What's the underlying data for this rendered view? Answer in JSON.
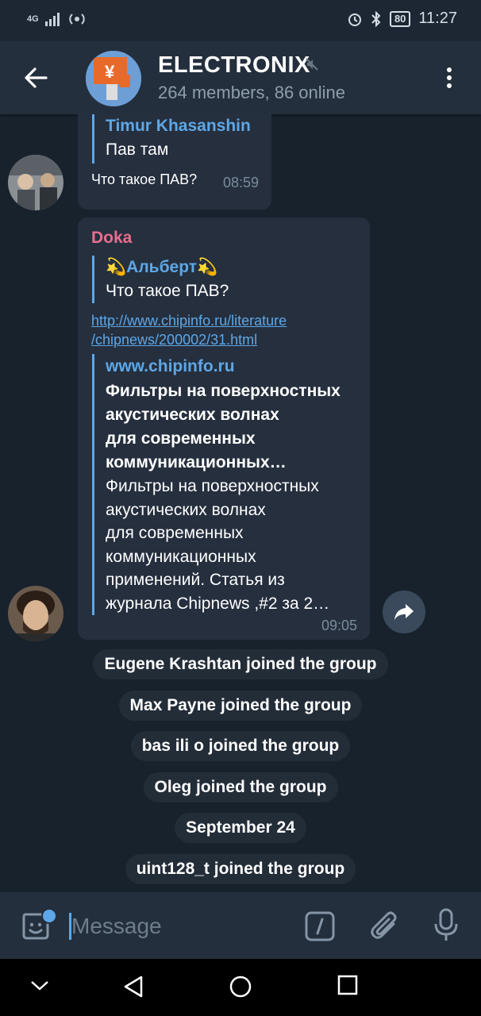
{
  "status_bar": {
    "network": "4G",
    "battery": "80",
    "time": "11:27"
  },
  "header": {
    "title": "ELECTRONIX",
    "subtitle": "264 members, 86 online"
  },
  "messages": [
    {
      "reply": {
        "name": "Timur Khasanshin",
        "text": "Пав там"
      },
      "text": "Что такое ПАВ?",
      "time": "08:59"
    },
    {
      "sender": "Doka",
      "sender_color": "#e86e8f",
      "reply": {
        "name": "💫Альберт💫",
        "text": "Что такое ПАВ?"
      },
      "link_line1": "http://www.chipinfo.ru/literature",
      "link_line2": "/chipnews/200002/31.html",
      "preview": {
        "site": "www.chipinfo.ru",
        "title_lines": [
          "Фильтры на поверхностных",
          "акустических волнах",
          "для современных",
          "коммуникационных…"
        ],
        "desc_lines": [
          "Фильтры на поверхностных",
          "акустических волнах",
          "для современных",
          "коммуникационных",
          "применений. Статья из",
          "журнала Chipnews ,#2 за 2…"
        ]
      },
      "time": "09:05"
    }
  ],
  "service_messages": [
    "Eugene Krashtan joined the group",
    "Max Payne joined the group",
    "bas ili o joined the group",
    "Oleg joined the group",
    "September 24",
    "uint128_t joined the group"
  ],
  "composer": {
    "placeholder": "Message"
  },
  "icons": {
    "back": "arrow-left-icon",
    "mute": "muted-icon",
    "menu": "more-vertical-icon",
    "share": "share-icon",
    "emoji": "sticker-icon",
    "command": "command-icon",
    "attach": "paperclip-icon",
    "mic": "microphone-icon"
  },
  "colors": {
    "accent": "#5ea7e6",
    "background": "#18222d",
    "bubble": "#252f3e",
    "header": "#242f3d"
  }
}
